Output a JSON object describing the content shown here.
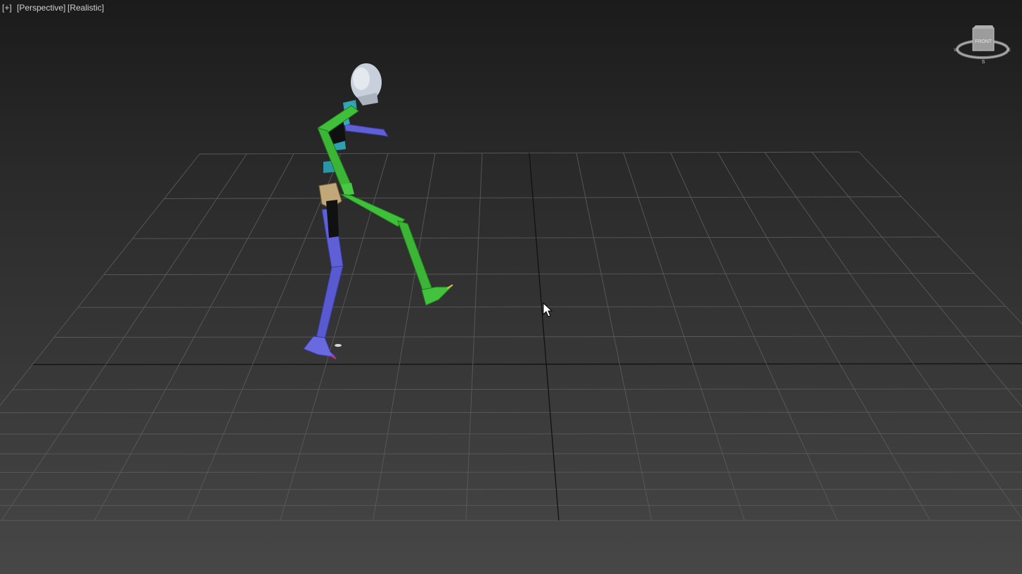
{
  "viewport": {
    "label_menu": "[+]",
    "label_view": "[Perspective]",
    "label_shading": "[Realistic]"
  },
  "viewcube": {
    "face_label": "FRONT",
    "compass_south": "S",
    "compass_west": "W",
    "compass_east": "E"
  },
  "colors": {
    "background_top": "#1b1b1b",
    "background_bottom": "#474747",
    "grid_line": "#5a5a5a",
    "grid_axis": "#111111",
    "biped_right_side": "#3fbf3a",
    "biped_left_side": "#5f5fd6",
    "biped_spine": "#2ea0b0",
    "biped_head": "#c8d0dc",
    "biped_pelvis": "#c2a878"
  },
  "icons": {
    "cursor": "arrow-cursor-icon",
    "viewcube": "viewcube-icon"
  }
}
